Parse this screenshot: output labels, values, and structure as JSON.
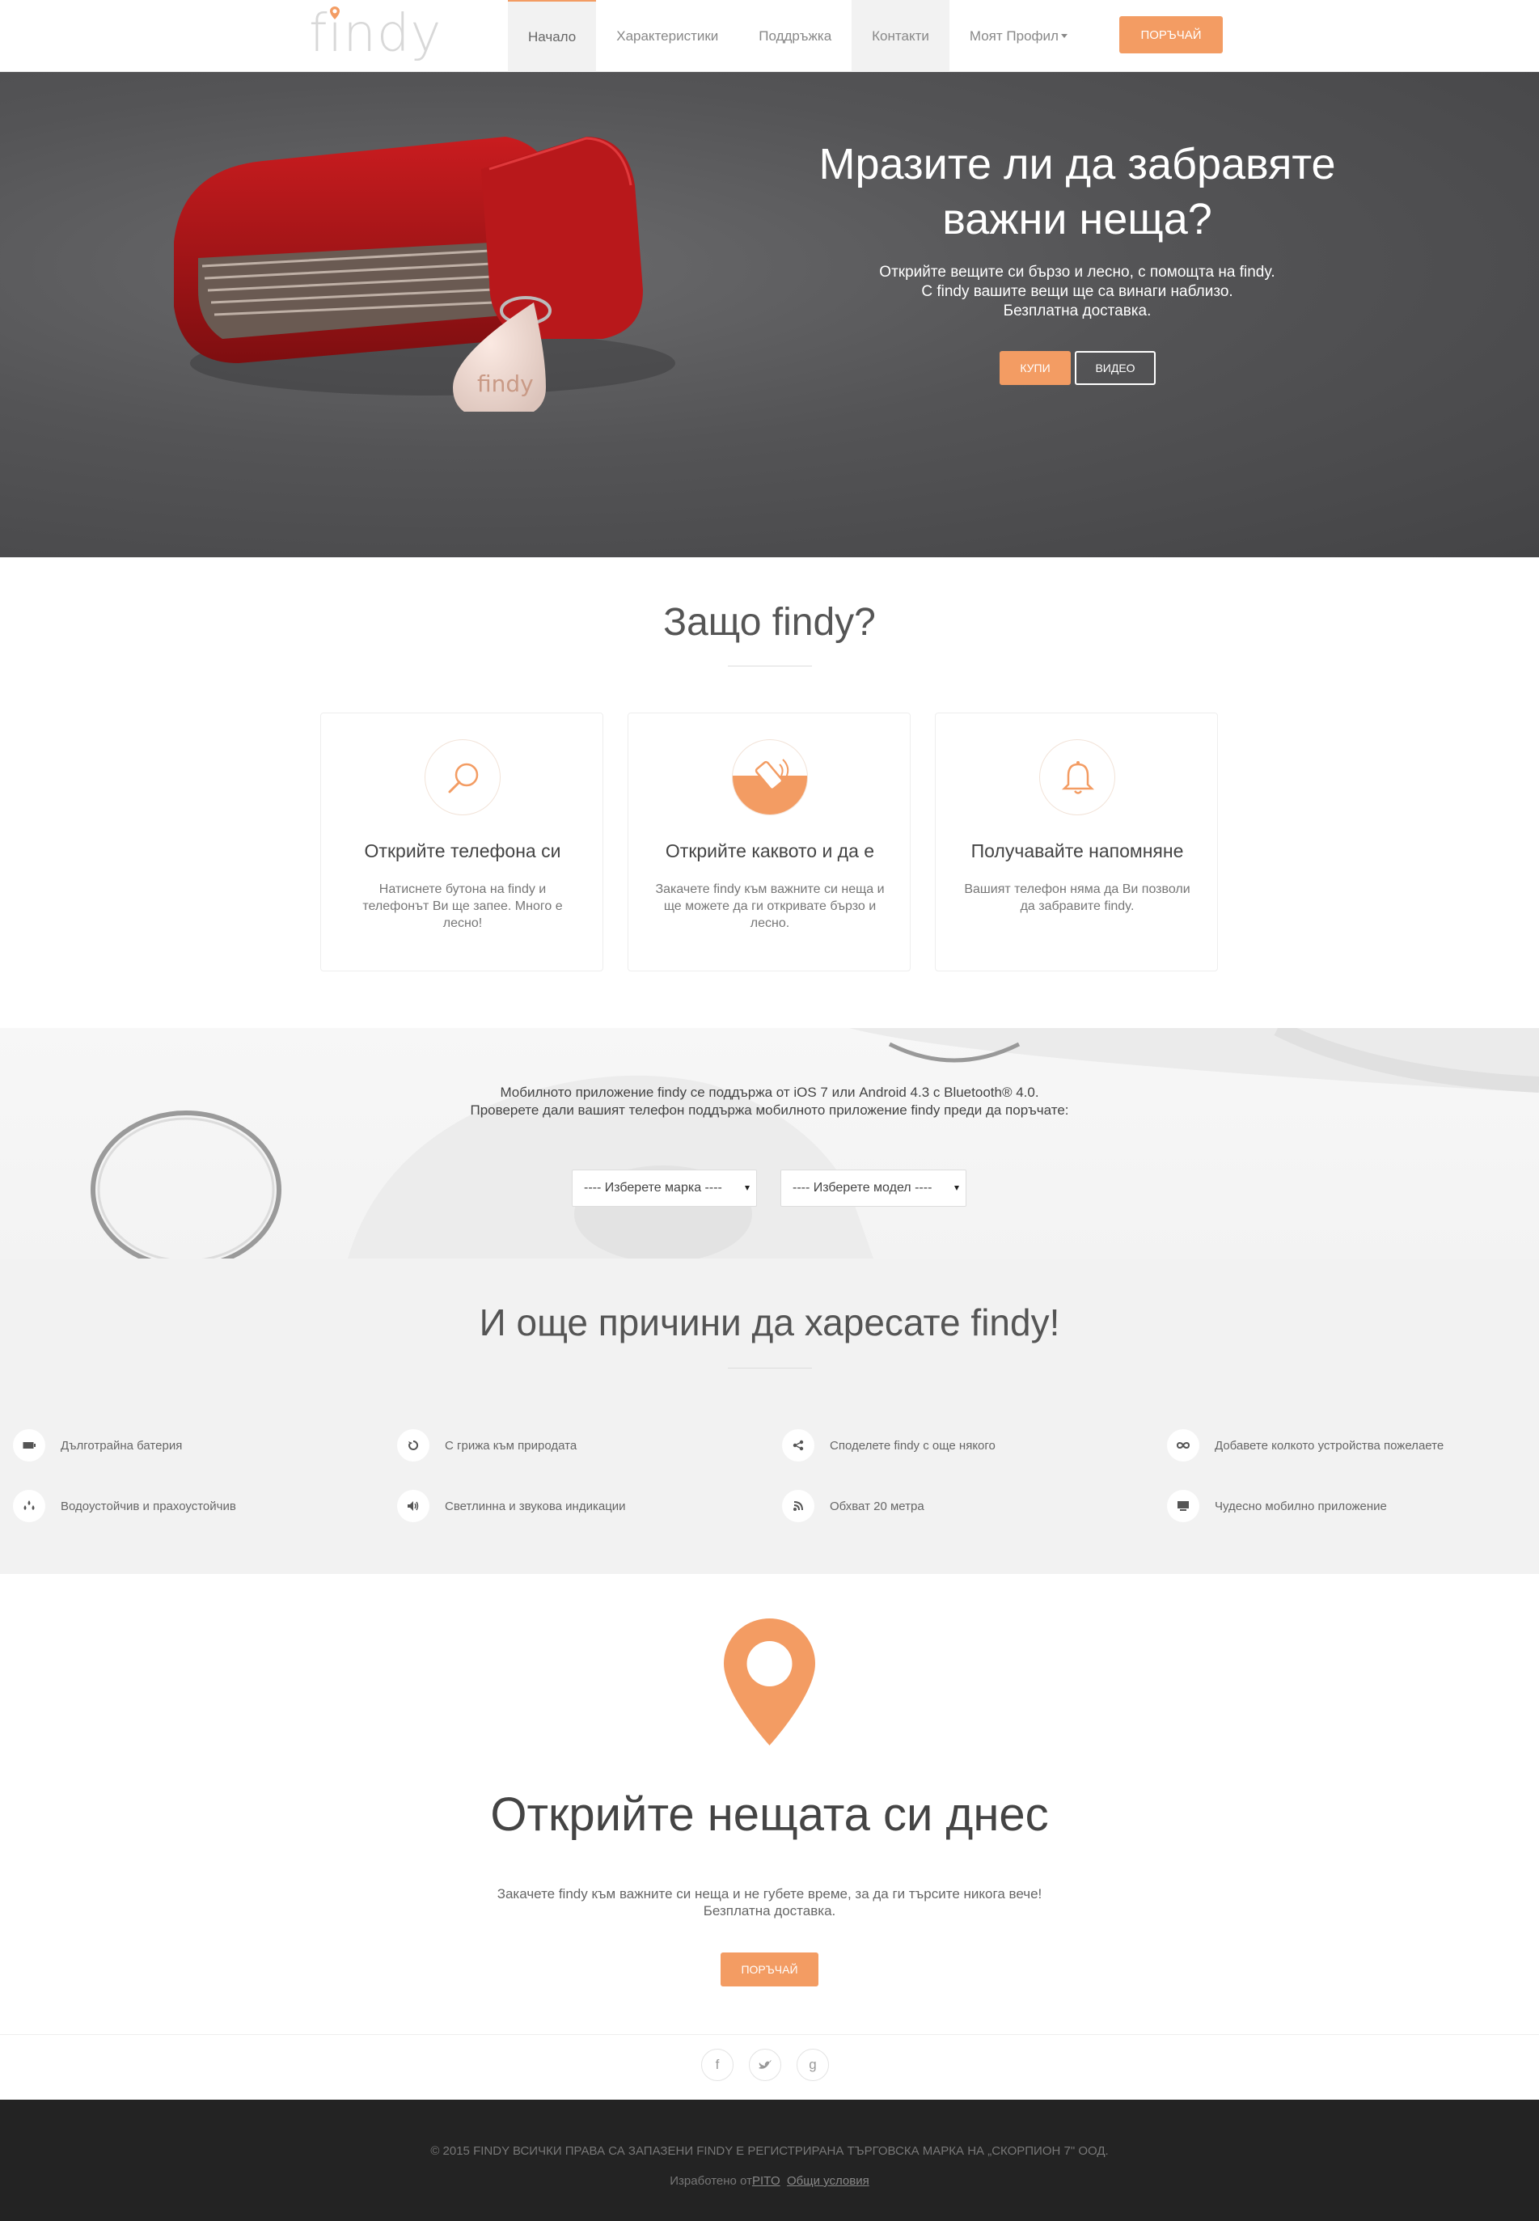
{
  "brand": {
    "logo_text": "findy",
    "accent_color": "#f39c63"
  },
  "nav": {
    "items": [
      {
        "label": "Начало",
        "active": true
      },
      {
        "label": "Характеристики"
      },
      {
        "label": "Поддръжка"
      },
      {
        "label": "Контакти"
      },
      {
        "label": "Моят Профил"
      }
    ],
    "order_button": "ПОРЪЧАЙ"
  },
  "hero": {
    "title_line1": "Мразите ли да забравяте",
    "title_line2": "важни неща?",
    "sub_line1": "Открийте вещите си бързо и лесно, с помощта на findy.",
    "sub_line2": "С findy вашите вещи ще са винаги наблизо.",
    "sub_line3": "Безплатна доставка.",
    "buy_button": "КУПИ",
    "video_button": "ВИДЕО"
  },
  "why": {
    "title": "Защо findy?",
    "cards": [
      {
        "icon": "magnifier-icon",
        "title": "Открийте телефона си",
        "text": "Натиснете бутона на findy и телефонът Ви ще запее. Много е лесно!"
      },
      {
        "icon": "phone-waves-icon",
        "title": "Открийте каквото и да е",
        "text": "Закачете findy към важните си неща и ще можете да ги откривате бързо и лесно."
      },
      {
        "icon": "bell-icon",
        "title": "Получавайте напомняне",
        "text": "Вашият телефон няма да Ви позволи да забравите findy."
      }
    ]
  },
  "compat": {
    "line1": "Мобилното приложение findy се поддържа от iOS 7 или Android 4.3 с Bluetooth® 4.0.",
    "line2": "Проверете дали вашият телефон поддържа мобилното приложение findy преди да поръчате:",
    "brand_select": "---- Изберете марка ----",
    "model_select": "---- Изберете модел ----"
  },
  "reasons": {
    "title": "И още причини да харесате findy!",
    "features": [
      {
        "icon": "battery-icon",
        "label": "Дълготрайна батерия"
      },
      {
        "icon": "recycle-icon",
        "label": "С грижа към природата"
      },
      {
        "icon": "share-icon",
        "label": "Споделете findy с още някого"
      },
      {
        "icon": "infinity-icon",
        "label": "Добавете колкото устройства пожелаете"
      },
      {
        "icon": "drops-icon",
        "label": "Водоустойчив и прахоустойчив"
      },
      {
        "icon": "speaker-icon",
        "label": "Светлинна и звукова индикации"
      },
      {
        "icon": "signal-icon",
        "label": "Обхват 20 метра"
      },
      {
        "icon": "app-icon",
        "label": "Чудесно мобилно приложение"
      }
    ]
  },
  "cta": {
    "title": "Открийте нещата си днес",
    "line1": "Закачете findy към важните си неща и не губете време, за да ги търсите никога вече!",
    "line2": "Безплатна доставка.",
    "button": "ПОРЪЧАЙ"
  },
  "social": {
    "facebook": "f",
    "twitter": "t",
    "google": "g"
  },
  "footer": {
    "copyright": "© 2015 FINDY ВСИЧКИ ПРАВА СА ЗАПАЗЕНИ FINDY Е РЕГИСТРИРАНА ТЪРГОВСКА МАРКА НА „СКОРПИОН 7\" ООД.",
    "made_by": "Изработено от",
    "made_by_link": "PITO",
    "terms_link": "Общи условия"
  }
}
